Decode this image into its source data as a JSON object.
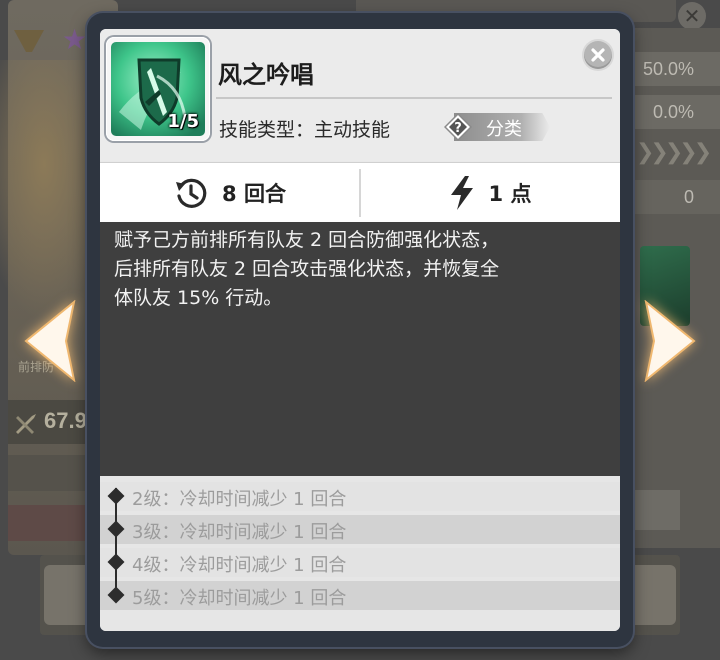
{
  "skill": {
    "name": "风之吟唱",
    "level": "1/5",
    "type_label": "技能类型：主动技能",
    "category_label": "分类",
    "icon": "wind-sword-shield-icon"
  },
  "stats": {
    "cooldown": {
      "icon": "cooldown-clock-icon",
      "value": "8 回合"
    },
    "cost": {
      "icon": "lightning-icon",
      "value": "1 点"
    }
  },
  "description": {
    "lines": [
      "赋予己方前排所有队友 2 回合防御强化状态，",
      "后排所有队友 2 回合攻击强化状态，并恢复全",
      "体队友 15% 行动。"
    ]
  },
  "upgrades": [
    {
      "text": "2级：冷却时间减少 1 回合"
    },
    {
      "text": "3级：冷却时间减少 1 回合"
    },
    {
      "text": "4级：冷却时间减少 1 回合"
    },
    {
      "text": "5级：冷却时间减少 1 回合"
    }
  ],
  "background": {
    "right_values": [
      "50.0%",
      "0.0%",
      "0"
    ],
    "left_stat": "67.9",
    "left_caption": "前排防"
  },
  "colors": {
    "modal_border": "#2e3540",
    "description_bg": "#3f3f3f",
    "icon_green": "#3ec58a"
  }
}
